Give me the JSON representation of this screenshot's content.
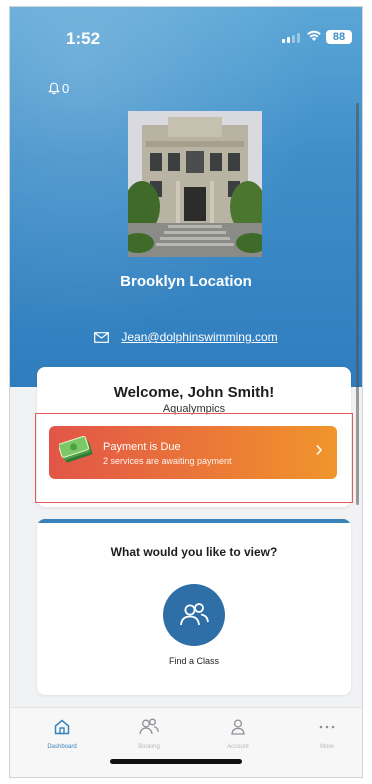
{
  "status_bar": {
    "time": "1:52",
    "battery": "88"
  },
  "header": {
    "notification_count": "0",
    "location_name": "Brooklyn Location",
    "email": "Jean@dolphinswimming.com"
  },
  "welcome_card": {
    "title": "Welcome, John Smith!",
    "subtitle": "Aqualympics"
  },
  "payment_banner": {
    "title": "Payment is Due",
    "subtitle": "2 services are awaiting payment",
    "icon": "money-icon",
    "colors": {
      "start": "#e25548",
      "end": "#f0952c"
    }
  },
  "view_card": {
    "question": "What would you like to view?",
    "options": [
      {
        "label": "Find a Class",
        "icon": "people-icon"
      }
    ]
  },
  "tab_bar": {
    "tabs": [
      {
        "label": "Dashboard",
        "icon": "home-icon",
        "active": true
      },
      {
        "label": "Booking",
        "icon": "people-icon",
        "active": false
      },
      {
        "label": "Account",
        "icon": "person-icon",
        "active": false
      },
      {
        "label": "More",
        "icon": "more-icon",
        "active": false
      }
    ]
  },
  "colors": {
    "primary": "#3a82ba",
    "hero_top": "#5aa6d6",
    "hero_bottom": "#2f7dbd",
    "highlight": "#e35b57"
  }
}
